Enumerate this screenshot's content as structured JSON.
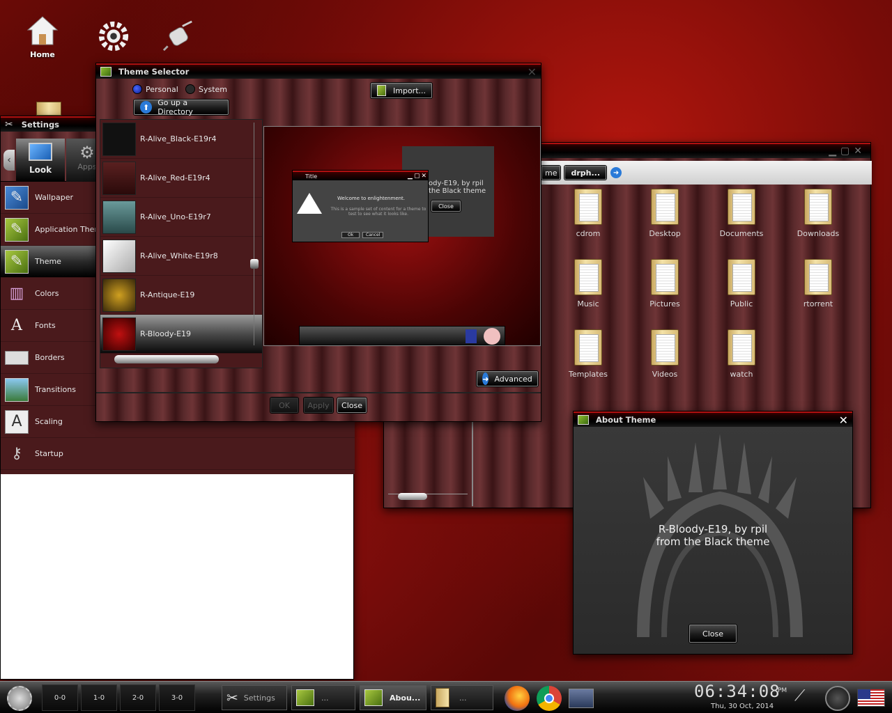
{
  "desktop": {
    "icons": [
      {
        "label": "Home"
      },
      {
        "label": ""
      },
      {
        "label": ""
      }
    ]
  },
  "settings": {
    "title": "Settings",
    "tabs": [
      {
        "label": "Look"
      },
      {
        "label": "Apps"
      }
    ],
    "items": [
      {
        "label": "Wallpaper"
      },
      {
        "label": "Application Theme"
      },
      {
        "label": "Theme"
      },
      {
        "label": "Colors"
      },
      {
        "label": "Fonts"
      },
      {
        "label": "Borders"
      },
      {
        "label": "Transitions"
      },
      {
        "label": "Scaling"
      },
      {
        "label": "Startup"
      }
    ]
  },
  "theme_selector": {
    "title": "Theme Selector",
    "personal_label": "Personal",
    "system_label": "System",
    "import_label": "Import...",
    "go_up_label": "Go up a Directory",
    "themes": [
      {
        "name": "R-Alive_Black-E19r4"
      },
      {
        "name": "R-Alive_Red-E19r4"
      },
      {
        "name": "R-Alive_Uno-E19r7"
      },
      {
        "name": "R-Alive_White-E19r8"
      },
      {
        "name": "R-Antique-E19"
      },
      {
        "name": "R-Bloody-E19"
      }
    ],
    "preview": {
      "dialog_title": "Title",
      "dialog_heading": "Welcome to enlightenment.",
      "dialog_body": "This is a sample set of content for a theme to test to see what it looks like.",
      "dialog_ok": "Ok",
      "dialog_cancel": "Cancel",
      "about_text": "ody-E19, by rpil the Black theme",
      "about_close": "Close"
    },
    "advanced_label": "Advanced",
    "ok_label": "OK",
    "apply_label": "Apply",
    "close_label": "Close"
  },
  "file_manager": {
    "path_parts": [
      "me",
      "drph..."
    ],
    "folders": [
      {
        "name": "cdrom"
      },
      {
        "name": "Desktop"
      },
      {
        "name": "Documents"
      },
      {
        "name": "Downloads"
      },
      {
        "name": "Music"
      },
      {
        "name": "Pictures"
      },
      {
        "name": "Public"
      },
      {
        "name": "rtorrent"
      },
      {
        "name": "Templates"
      },
      {
        "name": "Videos"
      },
      {
        "name": "watch"
      }
    ]
  },
  "about_theme": {
    "title": "About Theme",
    "line1": "R-Bloody-E19, by rpil",
    "line2": "from the Black theme",
    "close_label": "Close"
  },
  "taskbar": {
    "pagers": [
      "0-0",
      "1-0",
      "2-0",
      "3-0"
    ],
    "tasks": [
      {
        "label": "Settings"
      },
      {
        "label": "..."
      },
      {
        "label": "Abou..."
      },
      {
        "label": "..."
      }
    ],
    "clock_time": "06:34:08",
    "clock_ampm": "PM",
    "clock_date": "Thu, 30 Oct, 2014"
  },
  "colors": {
    "accent": "#b01010",
    "title_bg": "#000000"
  }
}
